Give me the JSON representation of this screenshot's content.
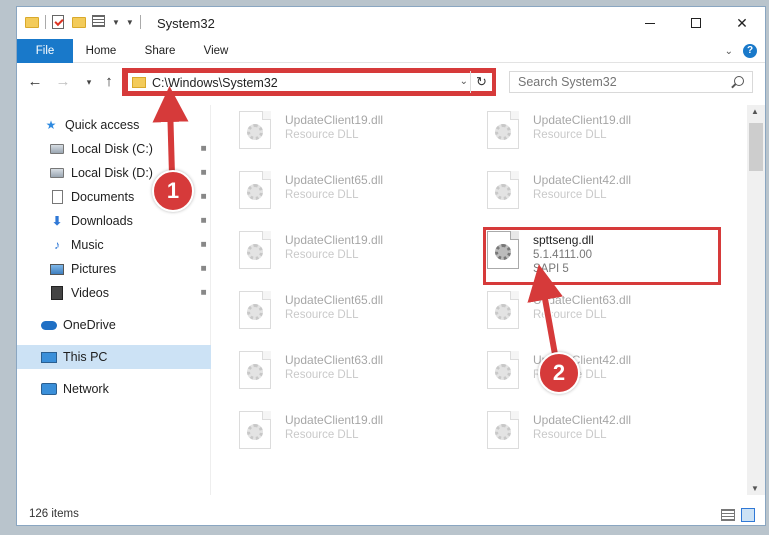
{
  "window": {
    "title": "System32",
    "minimize_glyph": "",
    "close_glyph": "✕"
  },
  "ribbon": {
    "tabs": [
      "File",
      "Home",
      "Share",
      "View"
    ]
  },
  "nav": {
    "back_glyph": "←",
    "forward_glyph": "→",
    "recent_glyph": "▾",
    "up_glyph": "↑",
    "address_path": "C:\\Windows\\System32",
    "address_dropdown_glyph": "⌄",
    "refresh_glyph": "↻",
    "search_placeholder": "Search System32"
  },
  "sidebar": {
    "items": [
      {
        "label": "Quick access",
        "icon": "star-icon",
        "pinned": false
      },
      {
        "label": "Local Disk (C:)",
        "icon": "disk-icon",
        "pinned": true
      },
      {
        "label": "Local Disk (D:)",
        "icon": "disk-icon",
        "pinned": true
      },
      {
        "label": "Documents",
        "icon": "documents-icon",
        "pinned": true
      },
      {
        "label": "Downloads",
        "icon": "downloads-icon",
        "pinned": true
      },
      {
        "label": "Music",
        "icon": "music-icon",
        "pinned": true
      },
      {
        "label": "Pictures",
        "icon": "pictures-icon",
        "pinned": true
      },
      {
        "label": "Videos",
        "icon": "videos-icon",
        "pinned": true
      },
      {
        "label": "OneDrive",
        "icon": "onedrive-icon",
        "pinned": false
      },
      {
        "label": "This PC",
        "icon": "this-pc-icon",
        "pinned": false,
        "selected": true
      },
      {
        "label": "Network",
        "icon": "network-icon",
        "pinned": false
      }
    ],
    "pin_glyph": "📌"
  },
  "files": {
    "left": [
      {
        "name": "UpdateClient19.dll",
        "sub": "Resource DLL"
      },
      {
        "name": "UpdateClient65.dll",
        "sub": "Resource DLL"
      },
      {
        "name": "UpdateClient19.dll",
        "sub": "Resource DLL"
      },
      {
        "name": "UpdateClient65.dll",
        "sub": "Resource DLL"
      },
      {
        "name": "UpdateClient63.dll",
        "sub": "Resource DLL"
      },
      {
        "name": "UpdateClient19.dll",
        "sub": "Resource DLL"
      }
    ],
    "right": [
      {
        "name": "UpdateClient19.dll",
        "sub": "Resource DLL"
      },
      {
        "name": "UpdateClient42.dll",
        "sub": "Resource DLL"
      },
      {
        "name": "spttseng.dll",
        "sub": "5.1.4111.00",
        "sub2": "SAPI 5",
        "active": true
      },
      {
        "name": "UpdateClient63.dll",
        "sub": "Resource DLL"
      },
      {
        "name": "UpdateClient42.dll",
        "sub": "Resource DLL"
      },
      {
        "name": "UpdateClient42.dll",
        "sub": "Resource DLL"
      }
    ]
  },
  "status": {
    "item_count": "126 items"
  },
  "annotations": {
    "step1": "1",
    "step2": "2",
    "highlight_color": "#d63a3a"
  },
  "colors": {
    "accent": "#1979ca",
    "selected_bg": "#cce2f5"
  }
}
